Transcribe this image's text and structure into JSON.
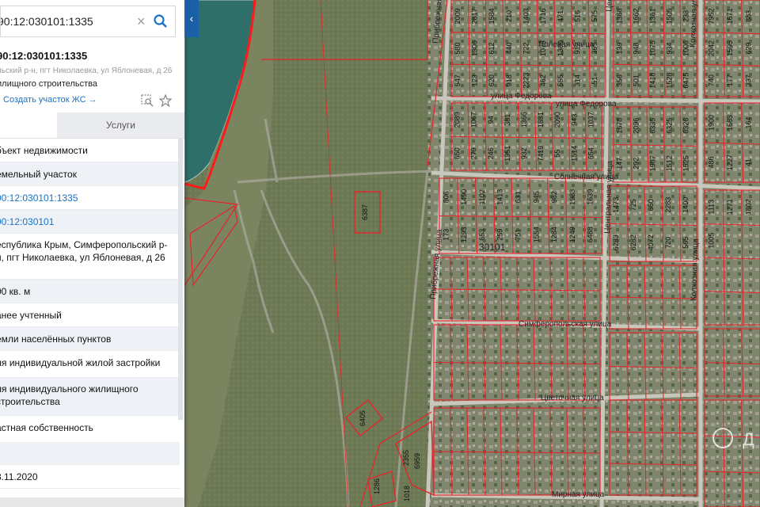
{
  "search": {
    "value": "90:12:030101:1335",
    "placeholder": ""
  },
  "parcel": {
    "cadastral_number": "90:12:030101:1335",
    "address_short": "льский р-н, пгт Николаевка, ул Яблоневая, д 26",
    "purpose": "илищного строительства",
    "create_link": "Создать участок ЖС →"
  },
  "tabs": {
    "services": "Услуги"
  },
  "rows": [
    {
      "text": "бъект недвижимости",
      "link": false
    },
    {
      "text": "емельный участок",
      "link": false
    },
    {
      "text": "90:12:030101:1335",
      "link": true
    },
    {
      "text": "90:12:030101",
      "link": true
    },
    {
      "text": "еспублика Крым, Симферопольский р-н, пгт Николаевка, ул Яблоневая, д 26",
      "link": false
    },
    {
      "text": "00 кв. м",
      "link": false
    },
    {
      "text": "анее учтенный",
      "link": false
    },
    {
      "text": "емли населённых пунктов",
      "link": false
    },
    {
      "text": "ля индивидуальной жилой застройки",
      "link": false
    },
    {
      "text": "ля индивидуального жилищного строительства",
      "link": false
    },
    {
      "text": "астная собственность",
      "link": false
    },
    {
      "text": "",
      "link": false
    },
    {
      "text": "3.11.2020",
      "link": false
    }
  ],
  "map": {
    "streets": [
      {
        "label": "Полевая улица"
      },
      {
        "label": "улица Федорова"
      },
      {
        "label": "улица Федорова"
      },
      {
        "label": "Солнечная улица"
      },
      {
        "label": "Центральная улица"
      },
      {
        "label": "Центральная улица"
      },
      {
        "label": "Прибрежная улица"
      },
      {
        "label": "Прибрежная улица"
      },
      {
        "label": "Симферопольская улица"
      },
      {
        "label": "Цветочная улица"
      },
      {
        "label": "Колхозная улица"
      },
      {
        "label": "Колхозная улица"
      },
      {
        "label": "Мирная улица"
      }
    ],
    "block_label": "30101",
    "plot_numbers": [
      "6387",
      "6405",
      "2355",
      "6959",
      "1286",
      "1018",
      "2009",
      "2817",
      "1584",
      "210",
      "1403",
      "1716",
      "471",
      "516",
      "575",
      "580",
      "1306",
      "612",
      "440",
      "722",
      "1075",
      "1300",
      "912",
      "365",
      "547",
      "123",
      "620",
      "918",
      "2223",
      "462",
      "555",
      "314",
      "51",
      "1388",
      "1662",
      "1381",
      "1505",
      "238",
      "139",
      "948",
      "1075",
      "934",
      "1006",
      "356",
      "501",
      "1418",
      "1528",
      "6475",
      "7952",
      "1671",
      "883",
      "2042",
      "1595",
      "629",
      "740",
      "177",
      "337",
      "2089",
      "1067",
      "94",
      "381",
      "1366",
      "1631",
      "2090",
      "943",
      "1037",
      "650",
      "279",
      "246",
      "1951",
      "932",
      "7419",
      "55",
      "1514",
      "654",
      "1678",
      "2096",
      "6335",
      "6325",
      "6326",
      "147",
      "292",
      "1987",
      "1512",
      "1525",
      "1900",
      "1663",
      "164",
      "486",
      "1227",
      "41",
      "806",
      "1490",
      "1102",
      "1413",
      "631",
      "945",
      "982",
      "1983",
      "1639",
      "173",
      "1293",
      "653",
      "259",
      "751",
      "1554",
      "1284",
      "1249",
      "6488",
      "1473",
      "725",
      "650",
      "2283",
      "1400",
      "6283",
      "6282",
      "4072",
      "720",
      "565",
      "1113",
      "1271",
      "1802",
      "1005"
    ],
    "watermark": "Д"
  },
  "colors": {
    "parcel_line": "#e8232a",
    "boundary": "#ff1a1a",
    "accent": "#1a73c8",
    "panel_bg": "#ffffff"
  }
}
